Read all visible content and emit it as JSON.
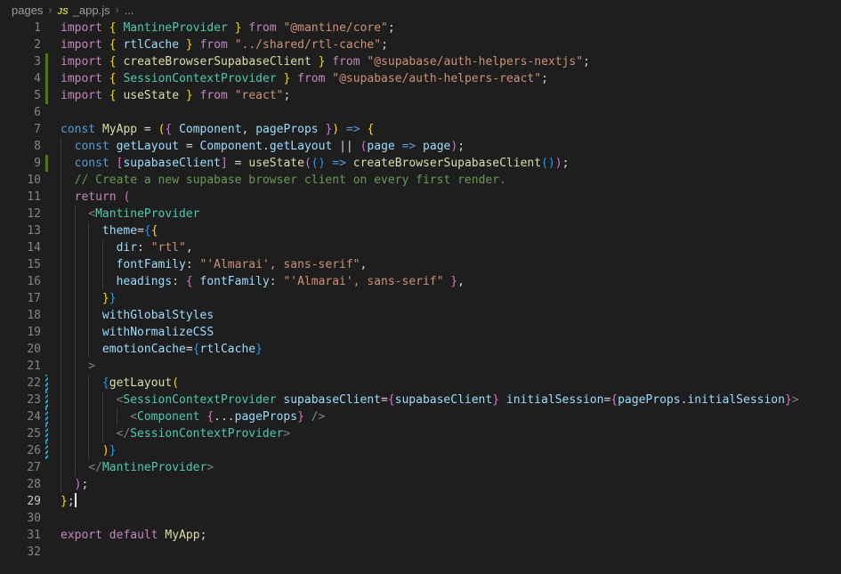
{
  "breadcrumb": {
    "separator": "›",
    "items": [
      {
        "label": "pages",
        "icon": null
      },
      {
        "label": "_app.js",
        "icon": "JS"
      },
      {
        "label": "...",
        "icon": null
      }
    ]
  },
  "palette": {
    "bg": "#1e1e1e",
    "breadcrumbFg": "#9d9d9d",
    "jsIcon": "#cbcb41",
    "lineNumber": "#858585",
    "lineNumberActive": "#c6c6c6",
    "indentGuide": "#3c3c3c",
    "cursor": "#e8e8e8",
    "gitAdded": "#487e02",
    "gitModified": "#29a3c7",
    "kw": "#c586c0",
    "kb": "#569cd6",
    "vr": "#9cdcfe",
    "cl": "#4ec9b0",
    "fn": "#dcdcaa",
    "st": "#ce9178",
    "cm": "#6a9955",
    "pu": "#d4d4d4",
    "an": "#808080",
    "b1": "#ffd700",
    "b2": "#da70d6",
    "b3": "#179fff"
  },
  "editor": {
    "cursor": {
      "line": 29
    },
    "gutter_markers": {
      "added": [
        3,
        4,
        5,
        9
      ],
      "modified": [
        22,
        23,
        24,
        25,
        26
      ]
    },
    "lines": [
      {
        "n": 1,
        "indent": 0,
        "tokens": [
          [
            "import ",
            "kw"
          ],
          [
            "{",
            "b1"
          ],
          [
            " ",
            "pu"
          ],
          [
            "MantineProvider",
            "cl"
          ],
          [
            " ",
            "pu"
          ],
          [
            "}",
            "b1"
          ],
          [
            " ",
            "pu"
          ],
          [
            "from",
            "kw"
          ],
          [
            " ",
            "pu"
          ],
          [
            "\"@mantine/core\"",
            "st"
          ],
          [
            ";",
            "pu"
          ]
        ]
      },
      {
        "n": 2,
        "indent": 0,
        "tokens": [
          [
            "import ",
            "kw"
          ],
          [
            "{",
            "b1"
          ],
          [
            " ",
            "pu"
          ],
          [
            "rtlCache",
            "vr"
          ],
          [
            " ",
            "pu"
          ],
          [
            "}",
            "b1"
          ],
          [
            " ",
            "pu"
          ],
          [
            "from",
            "kw"
          ],
          [
            " ",
            "pu"
          ],
          [
            "\"../shared/rtl-cache\"",
            "st"
          ],
          [
            ";",
            "pu"
          ]
        ]
      },
      {
        "n": 3,
        "indent": 0,
        "tokens": [
          [
            "import ",
            "kw"
          ],
          [
            "{",
            "b1"
          ],
          [
            " ",
            "pu"
          ],
          [
            "createBrowserSupabaseClient",
            "fn"
          ],
          [
            " ",
            "pu"
          ],
          [
            "}",
            "b1"
          ],
          [
            " ",
            "pu"
          ],
          [
            "from",
            "kw"
          ],
          [
            " ",
            "pu"
          ],
          [
            "\"@supabase/auth-helpers-nextjs\"",
            "st"
          ],
          [
            ";",
            "pu"
          ]
        ]
      },
      {
        "n": 4,
        "indent": 0,
        "tokens": [
          [
            "import ",
            "kw"
          ],
          [
            "{",
            "b1"
          ],
          [
            " ",
            "pu"
          ],
          [
            "SessionContextProvider",
            "cl"
          ],
          [
            " ",
            "pu"
          ],
          [
            "}",
            "b1"
          ],
          [
            " ",
            "pu"
          ],
          [
            "from",
            "kw"
          ],
          [
            " ",
            "pu"
          ],
          [
            "\"@supabase/auth-helpers-react\"",
            "st"
          ],
          [
            ";",
            "pu"
          ]
        ]
      },
      {
        "n": 5,
        "indent": 0,
        "tokens": [
          [
            "import ",
            "kw"
          ],
          [
            "{",
            "b1"
          ],
          [
            " ",
            "pu"
          ],
          [
            "useState",
            "fn"
          ],
          [
            " ",
            "pu"
          ],
          [
            "}",
            "b1"
          ],
          [
            " ",
            "pu"
          ],
          [
            "from",
            "kw"
          ],
          [
            " ",
            "pu"
          ],
          [
            "\"react\"",
            "st"
          ],
          [
            ";",
            "pu"
          ]
        ]
      },
      {
        "n": 6,
        "indent": 0,
        "tokens": []
      },
      {
        "n": 7,
        "indent": 0,
        "tokens": [
          [
            "const ",
            "kb"
          ],
          [
            "MyApp",
            "fn"
          ],
          [
            " = ",
            "pu"
          ],
          [
            "(",
            "b1"
          ],
          [
            "{",
            "b2"
          ],
          [
            " ",
            "pu"
          ],
          [
            "Component",
            "vr"
          ],
          [
            ", ",
            "pu"
          ],
          [
            "pageProps",
            "vr"
          ],
          [
            " ",
            "pu"
          ],
          [
            "}",
            "b2"
          ],
          [
            ")",
            "b1"
          ],
          [
            " ",
            "pu"
          ],
          [
            "=>",
            "kb"
          ],
          [
            " ",
            "pu"
          ],
          [
            "{",
            "b1"
          ]
        ]
      },
      {
        "n": 8,
        "indent": 2,
        "tokens": [
          [
            "const ",
            "kb"
          ],
          [
            "getLayout",
            "vr"
          ],
          [
            " = ",
            "pu"
          ],
          [
            "Component",
            "vr"
          ],
          [
            ".",
            "pu"
          ],
          [
            "getLayout",
            "vr"
          ],
          [
            " ",
            "pu"
          ],
          [
            "||",
            "pu"
          ],
          [
            " ",
            "pu"
          ],
          [
            "(",
            "b2"
          ],
          [
            "page",
            "vr"
          ],
          [
            " ",
            "pu"
          ],
          [
            "=>",
            "kb"
          ],
          [
            " ",
            "pu"
          ],
          [
            "page",
            "vr"
          ],
          [
            ")",
            "b2"
          ],
          [
            ";",
            "pu"
          ]
        ]
      },
      {
        "n": 9,
        "indent": 2,
        "tokens": [
          [
            "const ",
            "kb"
          ],
          [
            "[",
            "b2"
          ],
          [
            "supabaseClient",
            "vr"
          ],
          [
            "]",
            "b2"
          ],
          [
            " = ",
            "pu"
          ],
          [
            "useState",
            "fn"
          ],
          [
            "(",
            "b2"
          ],
          [
            "(",
            "b3"
          ],
          [
            ")",
            "b3"
          ],
          [
            " ",
            "pu"
          ],
          [
            "=>",
            "kb"
          ],
          [
            " ",
            "pu"
          ],
          [
            "createBrowserSupabaseClient",
            "fn"
          ],
          [
            "(",
            "b3"
          ],
          [
            ")",
            "b3"
          ],
          [
            ")",
            "b2"
          ],
          [
            ";",
            "pu"
          ]
        ]
      },
      {
        "n": 10,
        "indent": 2,
        "tokens": [
          [
            "// Create a new supabase browser client on every first render.",
            "cm"
          ]
        ]
      },
      {
        "n": 11,
        "indent": 2,
        "tokens": [
          [
            "return",
            "kw"
          ],
          [
            " ",
            "pu"
          ],
          [
            "(",
            "b2"
          ]
        ]
      },
      {
        "n": 12,
        "indent": 4,
        "tokens": [
          [
            "<",
            "an"
          ],
          [
            "MantineProvider",
            "cl"
          ]
        ]
      },
      {
        "n": 13,
        "indent": 6,
        "tokens": [
          [
            "theme",
            "vr"
          ],
          [
            "=",
            "pu"
          ],
          [
            "{",
            "b3"
          ],
          [
            "{",
            "b1"
          ]
        ]
      },
      {
        "n": 14,
        "indent": 8,
        "tokens": [
          [
            "dir",
            "vr"
          ],
          [
            ": ",
            "pu"
          ],
          [
            "\"rtl\"",
            "st"
          ],
          [
            ",",
            "pu"
          ]
        ]
      },
      {
        "n": 15,
        "indent": 8,
        "tokens": [
          [
            "fontFamily",
            "vr"
          ],
          [
            ": ",
            "pu"
          ],
          [
            "\"'Almarai', sans-serif\"",
            "st"
          ],
          [
            ",",
            "pu"
          ]
        ]
      },
      {
        "n": 16,
        "indent": 8,
        "tokens": [
          [
            "headings",
            "vr"
          ],
          [
            ": ",
            "pu"
          ],
          [
            "{",
            "b2"
          ],
          [
            " ",
            "pu"
          ],
          [
            "fontFamily",
            "vr"
          ],
          [
            ": ",
            "pu"
          ],
          [
            "\"'Almarai', sans-serif\"",
            "st"
          ],
          [
            " ",
            "pu"
          ],
          [
            "}",
            "b2"
          ],
          [
            ",",
            "pu"
          ]
        ]
      },
      {
        "n": 17,
        "indent": 6,
        "tokens": [
          [
            "}",
            "b1"
          ],
          [
            "}",
            "b3"
          ]
        ]
      },
      {
        "n": 18,
        "indent": 6,
        "tokens": [
          [
            "withGlobalStyles",
            "vr"
          ]
        ]
      },
      {
        "n": 19,
        "indent": 6,
        "tokens": [
          [
            "withNormalizeCSS",
            "vr"
          ]
        ]
      },
      {
        "n": 20,
        "indent": 6,
        "tokens": [
          [
            "emotionCache",
            "vr"
          ],
          [
            "=",
            "pu"
          ],
          [
            "{",
            "b3"
          ],
          [
            "rtlCache",
            "vr"
          ],
          [
            "}",
            "b3"
          ]
        ]
      },
      {
        "n": 21,
        "indent": 4,
        "tokens": [
          [
            ">",
            "an"
          ]
        ]
      },
      {
        "n": 22,
        "indent": 6,
        "tokens": [
          [
            "{",
            "b3"
          ],
          [
            "getLayout",
            "fn"
          ],
          [
            "(",
            "b1"
          ]
        ]
      },
      {
        "n": 23,
        "indent": 8,
        "tokens": [
          [
            "<",
            "an"
          ],
          [
            "SessionContextProvider",
            "cl"
          ],
          [
            " ",
            "pu"
          ],
          [
            "supabaseClient",
            "vr"
          ],
          [
            "=",
            "pu"
          ],
          [
            "{",
            "b2"
          ],
          [
            "supabaseClient",
            "vr"
          ],
          [
            "}",
            "b2"
          ],
          [
            " ",
            "pu"
          ],
          [
            "initialSession",
            "vr"
          ],
          [
            "=",
            "pu"
          ],
          [
            "{",
            "b2"
          ],
          [
            "pageProps",
            "vr"
          ],
          [
            ".",
            "pu"
          ],
          [
            "initialSession",
            "vr"
          ],
          [
            "}",
            "b2"
          ],
          [
            ">",
            "an"
          ]
        ]
      },
      {
        "n": 24,
        "indent": 10,
        "tokens": [
          [
            "<",
            "an"
          ],
          [
            "Component",
            "cl"
          ],
          [
            " ",
            "pu"
          ],
          [
            "{",
            "b2"
          ],
          [
            "...",
            "pu"
          ],
          [
            "pageProps",
            "vr"
          ],
          [
            "}",
            "b2"
          ],
          [
            " ",
            "pu"
          ],
          [
            "/>",
            "an"
          ]
        ]
      },
      {
        "n": 25,
        "indent": 8,
        "tokens": [
          [
            "</",
            "an"
          ],
          [
            "SessionContextProvider",
            "cl"
          ],
          [
            ">",
            "an"
          ]
        ]
      },
      {
        "n": 26,
        "indent": 6,
        "tokens": [
          [
            ")",
            "b1"
          ],
          [
            "}",
            "b3"
          ]
        ]
      },
      {
        "n": 27,
        "indent": 4,
        "tokens": [
          [
            "</",
            "an"
          ],
          [
            "MantineProvider",
            "cl"
          ],
          [
            ">",
            "an"
          ]
        ]
      },
      {
        "n": 28,
        "indent": 2,
        "tokens": [
          [
            ")",
            "b2"
          ],
          [
            ";",
            "pu"
          ]
        ]
      },
      {
        "n": 29,
        "indent": 0,
        "tokens": [
          [
            "}",
            "b1"
          ],
          [
            ";",
            "pu"
          ]
        ]
      },
      {
        "n": 30,
        "indent": 0,
        "tokens": []
      },
      {
        "n": 31,
        "indent": 0,
        "tokens": [
          [
            "export",
            "kw"
          ],
          [
            " ",
            "pu"
          ],
          [
            "default",
            "kw"
          ],
          [
            " ",
            "pu"
          ],
          [
            "MyApp",
            "fn"
          ],
          [
            ";",
            "pu"
          ]
        ]
      },
      {
        "n": 32,
        "indent": 0,
        "tokens": []
      }
    ]
  }
}
